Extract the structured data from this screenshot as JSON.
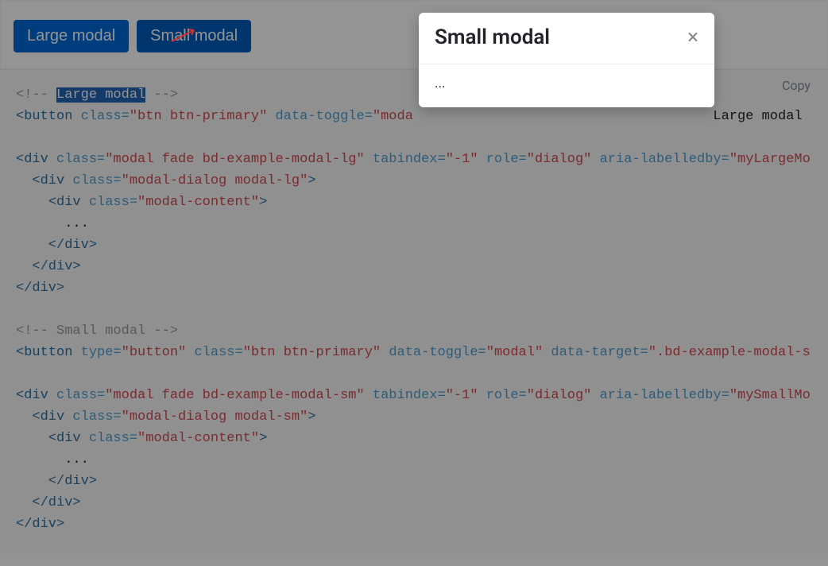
{
  "demo": {
    "buttons": {
      "large_label": "Large modal",
      "small_label": "Small modal"
    }
  },
  "code_toolbar": {
    "copy_label": "Copy"
  },
  "code": {
    "comment_large": " Large modal ",
    "comment_large_hl": "Large modal",
    "line2": {
      "tag_open": "<button",
      "attr1": "class=",
      "val1": "\"btn btn-primary\"",
      "attr2": "data-toggle=",
      "val2": "\"moda",
      "trail": "Large modal"
    },
    "line4": {
      "tag_open": "<div",
      "attr_class": "class=",
      "val_class": "\"modal fade bd-example-modal-lg\"",
      "attr_tab": "tabindex=",
      "val_tab": "\"-1\"",
      "attr_role": "role=",
      "val_role": "\"dialog\"",
      "attr_aria": "aria-labelledby=",
      "val_aria": "\"myLargeMo"
    },
    "line5": {
      "tag_open": "<div",
      "attr_class": "class=",
      "val_class": "\"modal-dialog modal-lg\"",
      "close": ">"
    },
    "line6": {
      "tag_open": "<div",
      "attr_class": "class=",
      "val_class": "\"modal-content\"",
      "close": ">"
    },
    "dots": "      ...",
    "close_div3": "    </div>",
    "close_div2": "  </div>",
    "close_div1": "</div>",
    "comment_small": " Small modal ",
    "line12": {
      "tag_open": "<button",
      "attr_type": "type=",
      "val_type": "\"button\"",
      "attr_class": "class=",
      "val_class": "\"btn btn-primary\"",
      "attr_toggle": "data-toggle=",
      "val_toggle": "\"modal\"",
      "attr_target": "data-target=",
      "val_target": "\".bd-example-modal-s"
    },
    "line14": {
      "tag_open": "<div",
      "attr_class": "class=",
      "val_class": "\"modal fade bd-example-modal-sm\"",
      "attr_tab": "tabindex=",
      "val_tab": "\"-1\"",
      "attr_role": "role=",
      "val_role": "\"dialog\"",
      "attr_aria": "aria-labelledby=",
      "val_aria": "\"mySmallMo"
    },
    "line15": {
      "tag_open": "<div",
      "attr_class": "class=",
      "val_class": "\"modal-dialog modal-sm\"",
      "close": ">"
    },
    "line16": {
      "tag_open": "<div",
      "attr_class": "class=",
      "val_class": "\"modal-content\"",
      "close": ">"
    }
  },
  "modal": {
    "title": "Small modal",
    "body": "...",
    "close_glyph": "×"
  }
}
